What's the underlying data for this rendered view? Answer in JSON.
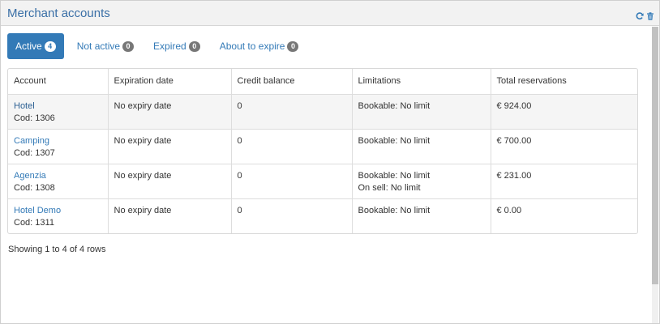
{
  "panel": {
    "title": "Merchant accounts",
    "icons": [
      "refresh-icon",
      "trash-icon"
    ]
  },
  "tabs": [
    {
      "label": "Active",
      "count": "4",
      "active": true
    },
    {
      "label": "Not active",
      "count": "0",
      "active": false
    },
    {
      "label": "Expired",
      "count": "0",
      "active": false
    },
    {
      "label": "About to expire",
      "count": "0",
      "active": false
    }
  ],
  "table": {
    "columns": [
      "Account",
      "Expiration date",
      "Credit balance",
      "Limitations",
      "Total reservations"
    ],
    "rows": [
      {
        "name": "Hotel",
        "cod": "Cod: 1306",
        "expiration": "No expiry date",
        "credit": "0",
        "limitations": [
          "Bookable: No limit"
        ],
        "total": "€ 924.00"
      },
      {
        "name": "Camping",
        "cod": "Cod: 1307",
        "expiration": "No expiry date",
        "credit": "0",
        "limitations": [
          "Bookable: No limit"
        ],
        "total": "€ 700.00"
      },
      {
        "name": "Agenzia",
        "cod": "Cod: 1308",
        "expiration": "No expiry date",
        "credit": "0",
        "limitations": [
          "Bookable: No limit",
          "On sell: No limit"
        ],
        "total": "€ 231.00"
      },
      {
        "name": "Hotel Demo",
        "cod": "Cod: 1311",
        "expiration": "No expiry date",
        "credit": "0",
        "limitations": [
          "Bookable: No limit"
        ],
        "total": "€ 0.00"
      }
    ]
  },
  "pagination": {
    "info": "Showing 1 to 4 of 4 rows"
  },
  "colors": {
    "accent": "#337ab7",
    "title": "#3a6fa6",
    "badge": "#777777"
  }
}
